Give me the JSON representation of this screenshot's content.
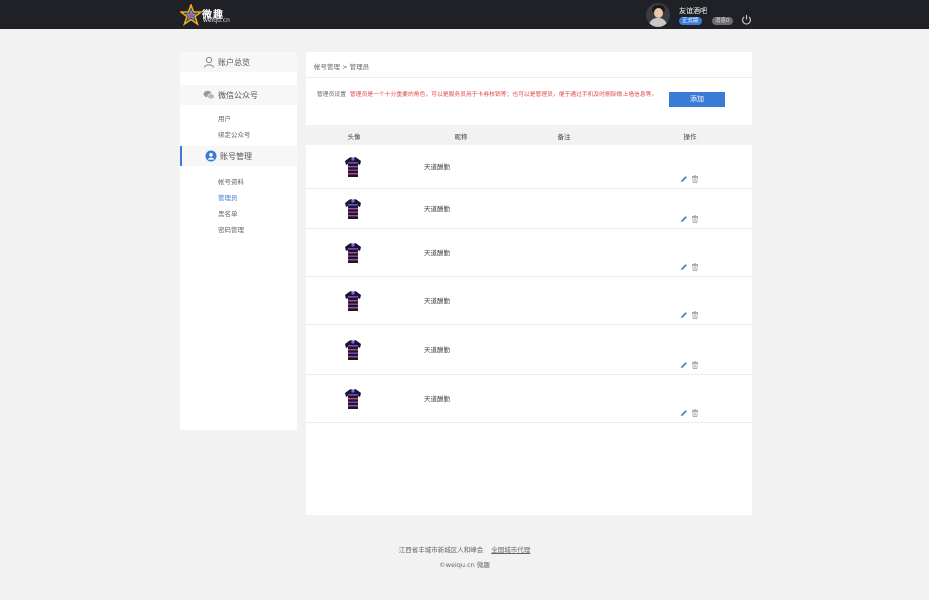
{
  "header": {
    "logo_cn": "微趣",
    "logo_en": "weiqu.cn",
    "user_name": "友谊酒吧",
    "badge_official": "正式版",
    "badge_msg": "消息0"
  },
  "sidebar": {
    "sections": [
      {
        "label": "账户总览",
        "icon": "user-icon"
      },
      {
        "label": "微信公众号",
        "icon": "wechat-icon",
        "links": [
          "用户",
          "绑定公众号"
        ]
      },
      {
        "label": "账号管理",
        "icon": "account-icon",
        "links": [
          "帐号资料",
          "管理员",
          "黑名单",
          "密码管理"
        ]
      }
    ]
  },
  "main": {
    "breadcrumb": "帐号管理 > 管理员",
    "notice_label": "管理员设置",
    "notice_text": "管理员是一个十分重要的角色，可以是服务员用于卡券核销等；也可以是管理员，便于通过手机及时删除微上墙信息等。",
    "add_button": "添加",
    "columns": [
      "头像",
      "昵称",
      "备注",
      "操作"
    ],
    "rows": [
      {
        "nickname": "天道酬勤",
        "remark": ""
      },
      {
        "nickname": "天道酬勤",
        "remark": ""
      },
      {
        "nickname": "天道酬勤",
        "remark": ""
      },
      {
        "nickname": "天道酬勤",
        "remark": ""
      },
      {
        "nickname": "天道酬勤",
        "remark": ""
      },
      {
        "nickname": "天道酬勤",
        "remark": ""
      }
    ]
  },
  "footer": {
    "address": "江西省丰城市新城区人和峰会",
    "link": "全国城市代理",
    "copyright": "©weiqu.cn 微趣"
  },
  "colors": {
    "accent": "#3a7bd5",
    "notice": "#e34a4a",
    "topbar": "#1f2126"
  }
}
